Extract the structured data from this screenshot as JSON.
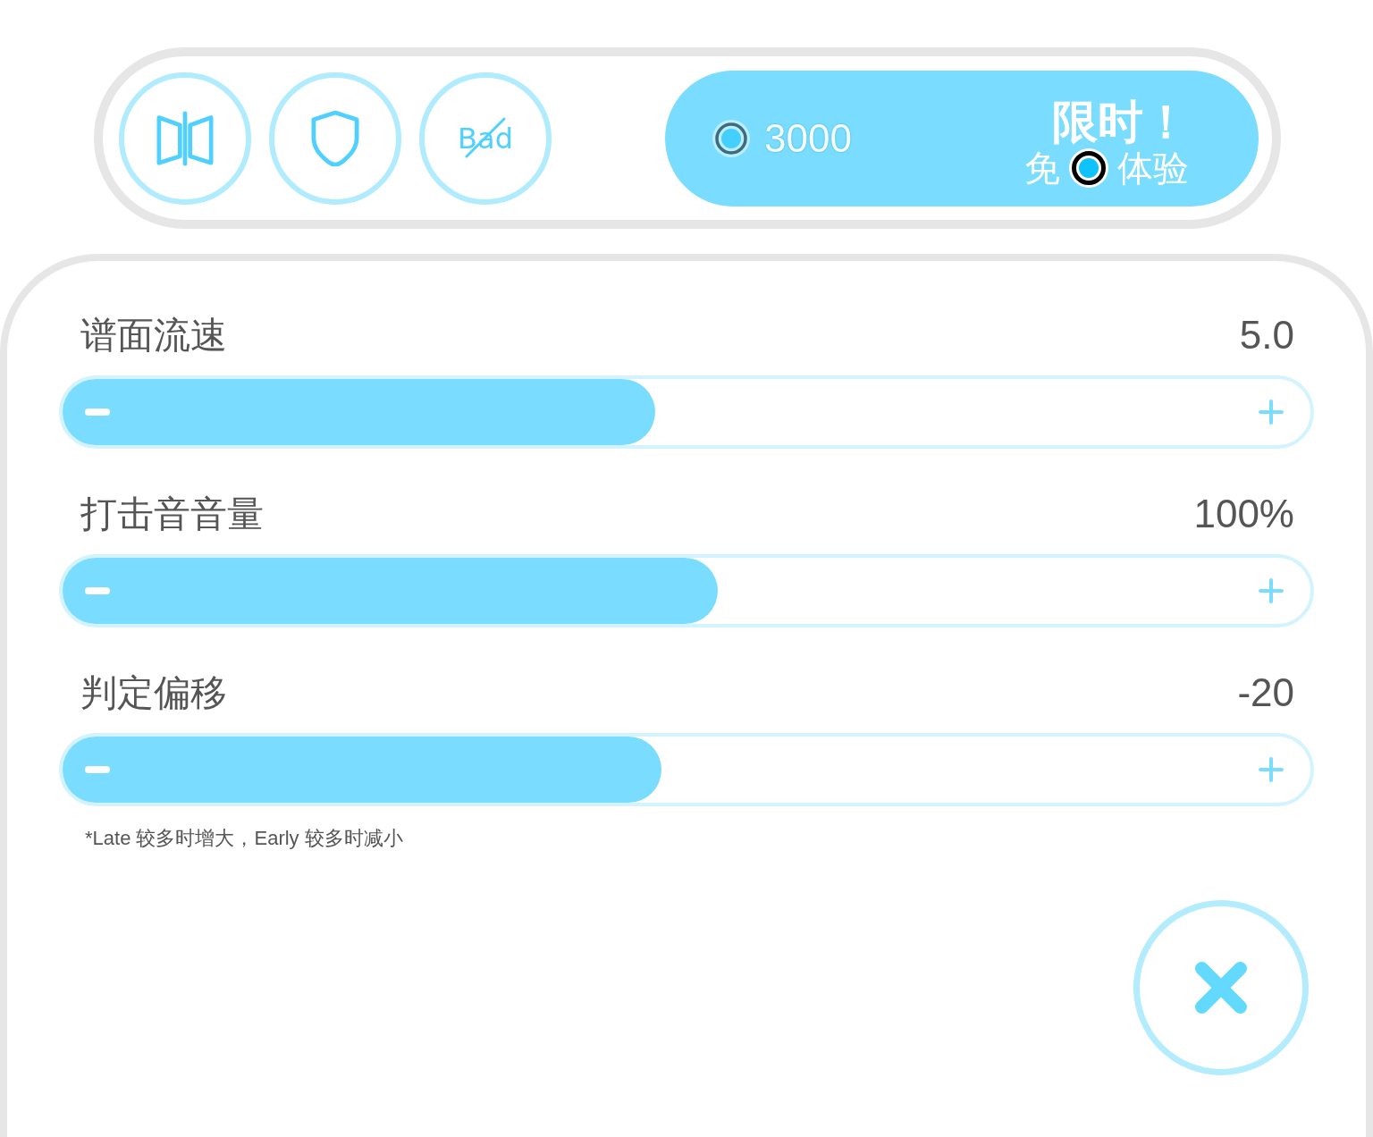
{
  "toolbar": [
    {
      "kind": "mirror"
    },
    {
      "kind": "shield"
    },
    {
      "kind": "crossed_text",
      "label": "Bad"
    }
  ],
  "promo": {
    "price": "3000",
    "title": "限时！",
    "text_before_icon": "免",
    "text_after_icon": "体验"
  },
  "settings": [
    {
      "label": "谱面流速",
      "value": "5.0",
      "level": 0.475
    },
    {
      "label": "打击音音量",
      "value": "100%",
      "level": 0.525
    },
    {
      "label": "判定偏移",
      "value": "-20",
      "level": 0.48
    }
  ],
  "footnote": "*Late 较多时增大，Early 较多时减小"
}
